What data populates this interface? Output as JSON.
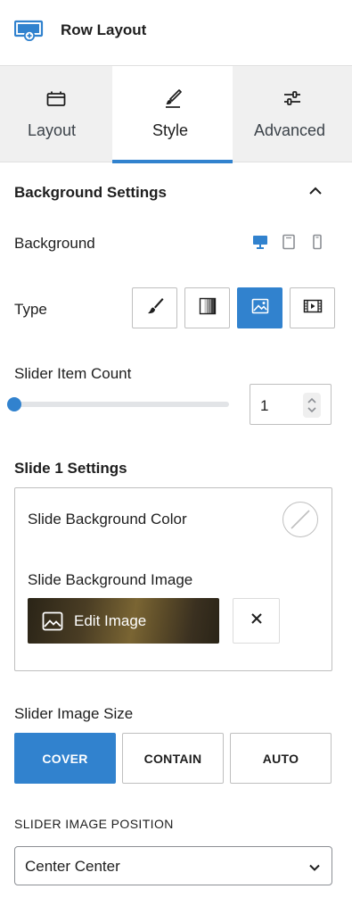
{
  "header": {
    "title": "Row Layout",
    "icon": "row-layout-icon"
  },
  "tabs": [
    {
      "label": "Layout",
      "icon": "layout-icon",
      "active": false
    },
    {
      "label": "Style",
      "icon": "brush-icon",
      "active": true
    },
    {
      "label": "Advanced",
      "icon": "sliders-icon",
      "active": false
    }
  ],
  "background_settings": {
    "title": "Background Settings",
    "background_label": "Background",
    "devices": [
      "desktop",
      "tablet",
      "mobile"
    ],
    "type_label": "Type",
    "type_options": [
      "color",
      "gradient",
      "image",
      "video"
    ],
    "type_selected": "image"
  },
  "slider": {
    "count_label": "Slider Item Count",
    "count_value": "1",
    "count_level": 0
  },
  "slide_settings": {
    "title": "Slide 1 Settings",
    "bg_color_label": "Slide Background Color",
    "bg_image_label": "Slide Background Image",
    "edit_image_label": "Edit Image",
    "remove_symbol": "✕"
  },
  "image_size": {
    "label": "Slider Image Size",
    "options": [
      "COVER",
      "CONTAIN",
      "AUTO"
    ],
    "selected": "COVER"
  },
  "image_position": {
    "label": "SLIDER IMAGE POSITION",
    "value": "Center Center"
  },
  "colors": {
    "accent": "#3182ce",
    "tab_bg": "#f0f0f0",
    "text": "#1e1e1e"
  }
}
